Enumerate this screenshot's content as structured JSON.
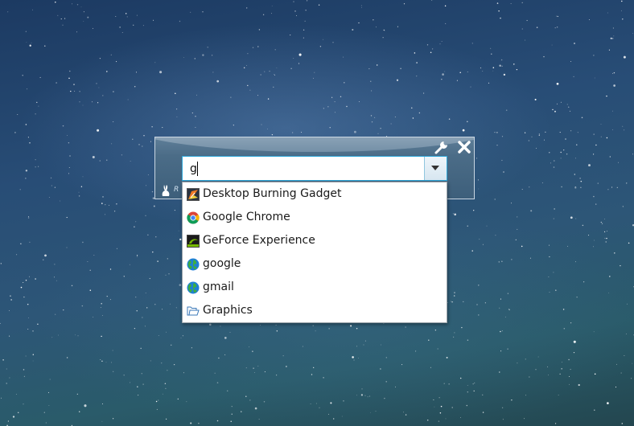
{
  "desktop": {
    "wallpaper": "starfield-night-sky"
  },
  "launcher": {
    "brand_text": "R",
    "icons": {
      "tools": "wrench-icon",
      "close": "close-icon",
      "logo": "rabbit-icon"
    },
    "colors": {
      "focus_border": "#2ea6d8",
      "panel": "#4b6c87"
    }
  },
  "search": {
    "value": "g",
    "placeholder": ""
  },
  "suggestions": [
    {
      "label": "Desktop Burning Gadget",
      "icon": "gadget-app-icon"
    },
    {
      "label": "Google Chrome",
      "icon": "chrome-icon"
    },
    {
      "label": "GeForce Experience",
      "icon": "geforce-icon"
    },
    {
      "label": "google",
      "icon": "globe-icon"
    },
    {
      "label": "gmail",
      "icon": "globe-icon"
    },
    {
      "label": "Graphics",
      "icon": "folder-icon"
    }
  ]
}
